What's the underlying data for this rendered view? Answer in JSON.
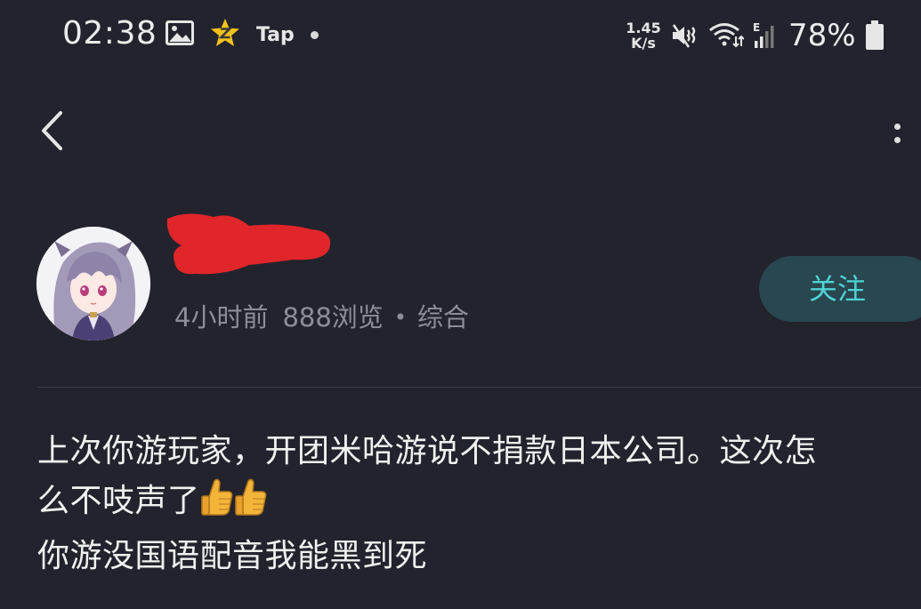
{
  "status_bar": {
    "time": "02:38",
    "app_icons": [
      "gallery-icon",
      "star-z-icon",
      "tap-icon"
    ],
    "tap_label": "Tap",
    "net_speed_value": "1.45",
    "net_speed_unit": "K/s",
    "signal_type": "E",
    "battery_percent": "78%"
  },
  "nav": {
    "back_icon": "chevron-left-icon",
    "more_icon": "more-vertical-icon"
  },
  "post": {
    "author_name_redacted": true,
    "time_ago": "4小时前",
    "views": "888浏览",
    "separator": "•",
    "category": "综合",
    "follow_label": "关注",
    "body_line_1": "上次你游玩家，开团米哈游说不捐款日本公司。这次怎",
    "body_line_2": "么不吱声了",
    "body_line_2_emoji": "thumbs-up-icon",
    "body_line_2_emoji_count": 2,
    "body_line_3": "你游没国语配音我能黑到死"
  },
  "colors": {
    "background": "#22232d",
    "follow_bg": "#28474e",
    "follow_text": "#4fd2d6",
    "meta_text": "#8d8e96",
    "redaction": "#e0262a"
  }
}
